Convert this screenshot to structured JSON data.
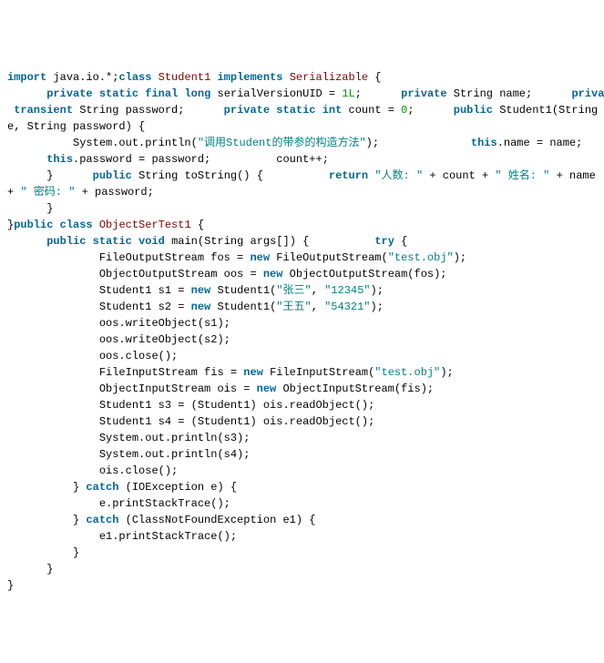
{
  "code": {
    "kw_import": "import",
    "pkg_io": "java.io.*",
    "kw_class": "class",
    "cls_student": "Student1",
    "kw_implements": "implements",
    "cls_serializable": "Serializable",
    "kw_private": "private",
    "kw_static": "static",
    "kw_final": "final",
    "kw_long": "long",
    "id_serial": "serialVersionUID",
    "num_1L": "1L",
    "cls_string": "String",
    "id_name": "name",
    "kw_transient": "transient",
    "id_password": "password",
    "kw_int": "int",
    "id_count": "count",
    "num_0": "0",
    "kw_public": "public",
    "ctor_student": "Student1",
    "par_name": "(String nam",
    "par_cont": "e, String password) {",
    "stmt_so": "System.out.println(",
    "str_ctor": "\"调用Student的带参的构造方法\"",
    "stmt_close": ");",
    "kw_this": "this",
    "stmt_this_name": ".name = name;",
    "stmt_this_pw": ".password = password;",
    "stmt_countpp": "count++;",
    "stmt_brace_close": "}",
    "ret_string": "String",
    "id_tostring": "toString",
    "empty_params": "()",
    "kw_return": "return",
    "str_count": "\"人数: \"",
    "plus_count": " + count + ",
    "str_name": "\" 姓名: \"",
    "plus_name": " + name",
    "plus_plus": "+ ",
    "str_pw": "\" 密码: \"",
    "plus_pw": " + password;",
    "cls_test": "ObjectSerTest1",
    "kw_void": "void",
    "id_main": "main",
    "main_params": "(String args[])",
    "kw_try": "try",
    "stmt_fos": "FileOutputStream fos = ",
    "kw_new": "new",
    "ctor_fos": " FileOutputStream(",
    "str_testobj": "\"test.obj\"",
    "stmt_closep": ");",
    "stmt_oos": "ObjectOutputStream oos = ",
    "ctor_oos": " ObjectOutputStream(fos);",
    "stmt_s1": "Student1 s1 = ",
    "ctor_s1": " Student1(",
    "str_zhang": "\"张三\"",
    "comma": ", ",
    "str_12345": "\"12345\"",
    "stmt_s2": "Student1 s2 = ",
    "str_wang": "\"王五\"",
    "str_54321": "\"54321\"",
    "stmt_write1": "oos.writeObject(s1);",
    "stmt_write2": "oos.writeObject(s2);",
    "stmt_oosclose": "oos.close();",
    "stmt_fis": "FileInputStream fis = ",
    "ctor_fis": " FileInputStream(",
    "stmt_ois": "ObjectInputStream ois = ",
    "ctor_ois": " ObjectInputStream(fis);",
    "stmt_s3": "Student1 s3 = (Student1) ois.readObject();",
    "stmt_s4": "Student1 s4 = (Student1) ois.readObject();",
    "stmt_print3": "System.out.println(s3);",
    "stmt_print4": "System.out.println(s4);",
    "stmt_oisclose": "ois.close();",
    "kw_catch": "catch",
    "catch_io": " (IOException e) {",
    "stmt_eprint": "e.printStackTrace();",
    "catch_cnf": " (ClassNotFoundException e1) {",
    "stmt_e1print": "e1.printStackTrace();"
  }
}
